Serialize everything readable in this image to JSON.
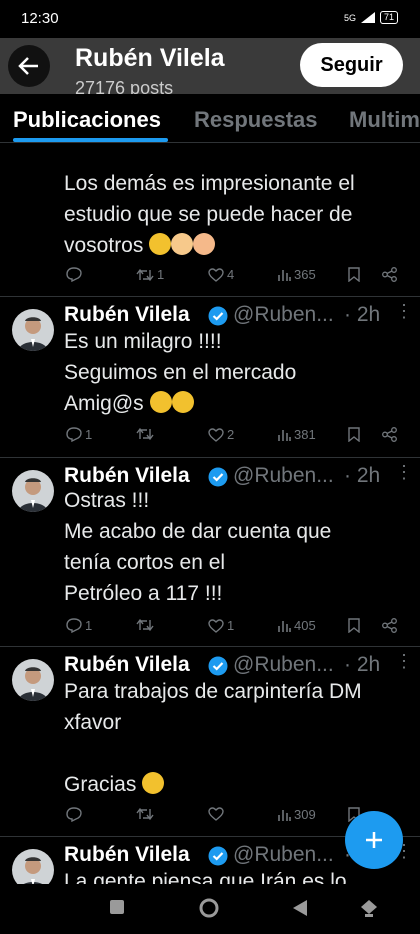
{
  "status_bar": {
    "time": "12:30",
    "network": "5G",
    "battery": "71"
  },
  "header": {
    "name": "Rubén Vilela",
    "posts_count": "27176 posts",
    "follow_label": "Seguir"
  },
  "tabs": [
    {
      "label": "Publicaciones"
    },
    {
      "label": "Respuestas"
    },
    {
      "label": "Multim"
    }
  ],
  "posts": [
    {
      "text": "Los demás es impresionante el\nestudio que se puede hacer de\nvosotros",
      "emojis": [
        "zany-face-emoji",
        "raising-hands-emoji",
        "flexed-biceps-emoji"
      ],
      "replies": "",
      "reposts": "1",
      "likes": "4",
      "views": "365"
    },
    {
      "author": "Rubén Vilela",
      "handle": "@Ruben...",
      "time": "· 2h",
      "text": "Es un milagro !!!!\nSeguimos en el mercado\nAmig@s",
      "emojis": [
        "zany-face-emoji",
        "smiling-face-emoji"
      ],
      "replies": "1",
      "reposts": "",
      "likes": "2",
      "views": "381"
    },
    {
      "author": "Rubén Vilela",
      "handle": "@Ruben...",
      "time": "· 2h",
      "text": "Ostras !!!\nMe acabo de dar cuenta que\ntenía cortos en el\nPetróleo a 117 !!!",
      "replies": "1",
      "reposts": "",
      "likes": "1",
      "views": "405"
    },
    {
      "author": "Rubén Vilela",
      "handle": "@Ruben...",
      "time": "· 2h",
      "text": "Para trabajos de carpintería DM\nxfavor\n\nGracias",
      "emojis": [
        "pleading-face-emoji"
      ],
      "replies": "",
      "reposts": "",
      "likes": "",
      "views": "309"
    },
    {
      "author": "Rubén Vilela",
      "handle": "@Ruben...",
      "time": "· 2h",
      "text": "La gente piensa que Irán es lo"
    }
  ],
  "colors": {
    "accent": "#1d9bf0",
    "background": "#000000",
    "muted": "#71767b",
    "divider": "#2f3336"
  }
}
